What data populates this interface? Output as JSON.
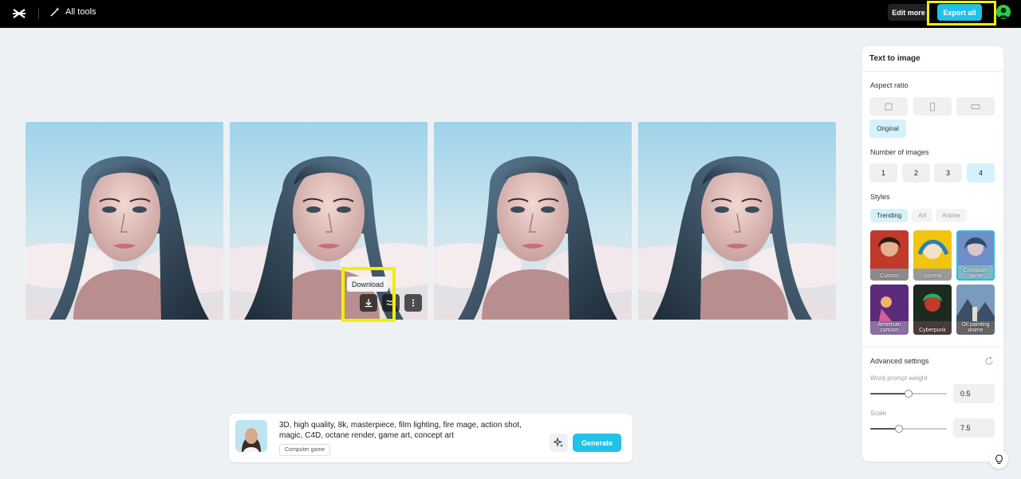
{
  "topbar": {
    "all_tools_label": "All tools",
    "edit_more_label": "Edit more",
    "export_all_label": "Export all"
  },
  "gallery": {
    "tooltip_download": "Download",
    "images": [
      "portrait-1",
      "portrait-2",
      "portrait-3",
      "portrait-4"
    ]
  },
  "prompt": {
    "text": "3D, high quality, 8k, masterpiece, film lighting, fire mage, action shot, magic, C4D, octane render, game art, concept art",
    "style_tag": "Computer game",
    "generate_label": "Generate"
  },
  "panel": {
    "title": "Text to image",
    "aspect_ratio_label": "Aspect ratio",
    "original_label": "Original",
    "num_images_label": "Number of images",
    "num_options": [
      "1",
      "2",
      "3",
      "4"
    ],
    "num_selected": "4",
    "styles_label": "Styles",
    "style_tabs": [
      "Trending",
      "Art",
      "Anime"
    ],
    "style_tiles": [
      {
        "label": "Custom"
      },
      {
        "label": "Surreal"
      },
      {
        "label": "Computer game"
      },
      {
        "label": "American cartoon"
      },
      {
        "label": "Cyberpunk"
      },
      {
        "label": "Oil painting anime"
      }
    ],
    "advanced_label": "Advanced settings",
    "word_prompt_label": "Word prompt weight",
    "word_prompt_value": "0.5",
    "word_prompt_level": 0.5,
    "scale_label": "Scale",
    "scale_value": "7.5",
    "scale_level": 0.38
  },
  "colors": {
    "accent": "#21c1e8",
    "highlight": "#f2ef00",
    "selected_bg": "#d4f2fb"
  }
}
